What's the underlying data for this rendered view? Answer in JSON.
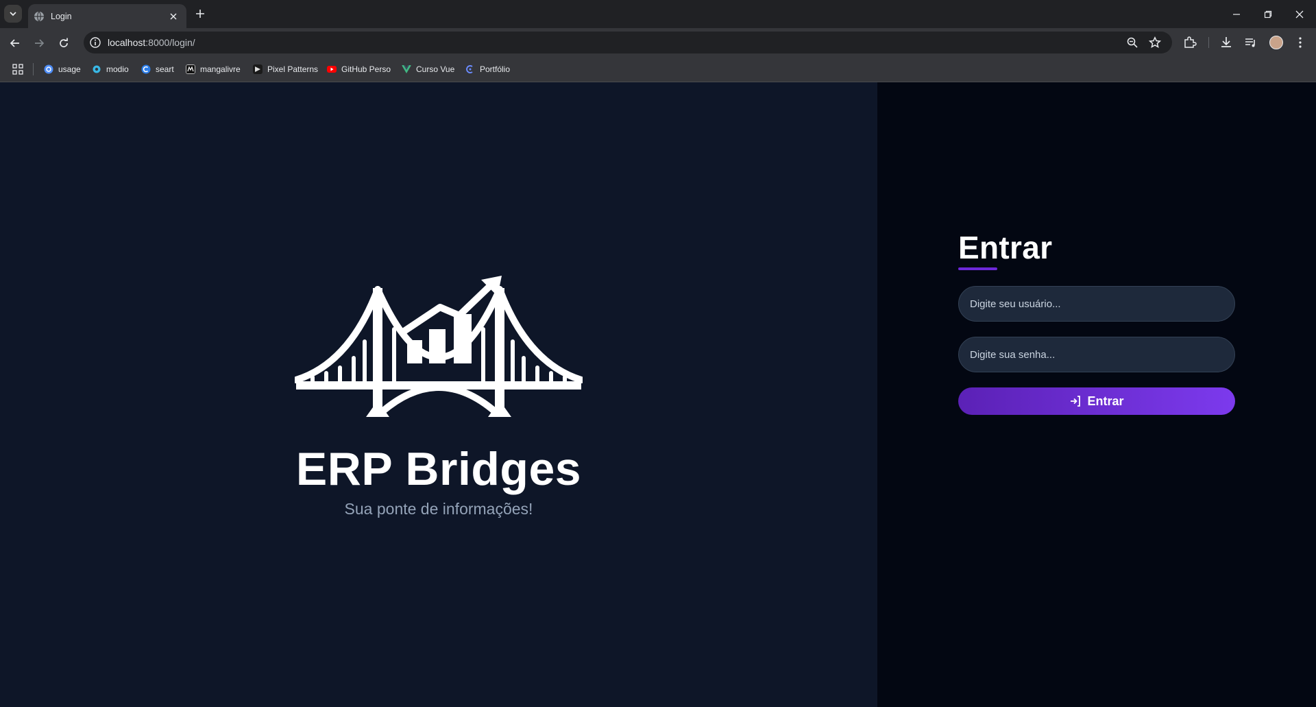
{
  "browser": {
    "tab_title": "Login",
    "url_host": "localhost",
    "url_path": ":8000/login/",
    "bookmarks": [
      {
        "label": "usage",
        "icon": "usage-icon",
        "color": "#4f8ef7"
      },
      {
        "label": "modio",
        "icon": "modio-icon",
        "color": "#39b8e6"
      },
      {
        "label": "seart",
        "icon": "seart-icon",
        "color": "#2b7de9"
      },
      {
        "label": "mangalivre",
        "icon": "mangalivre-icon",
        "color": "#111111"
      },
      {
        "label": "Pixel Patterns",
        "icon": "pixel-patterns-icon",
        "color": "#1a1a1a"
      },
      {
        "label": "GitHub Perso",
        "icon": "youtube-icon",
        "color": "#ff0000"
      },
      {
        "label": "Curso Vue",
        "icon": "vue-icon",
        "color": "#41b883"
      },
      {
        "label": "Portfólio",
        "icon": "portfolio-icon",
        "color": "#6b8cff"
      }
    ]
  },
  "brand": {
    "title": "ERP Bridges",
    "subtitle": "Sua ponte de informações!",
    "logo_icon": "bridge-chart-logo-icon"
  },
  "login": {
    "title": "Entrar",
    "username_placeholder": "Digite seu usuário...",
    "password_placeholder": "Digite sua senha...",
    "submit_label": "Entrar",
    "submit_icon": "login-arrow-icon"
  },
  "colors": {
    "left_bg": "#0e1628",
    "right_bg": "#030712",
    "accent": "#6d28d9",
    "input_bg": "#1e293b"
  }
}
